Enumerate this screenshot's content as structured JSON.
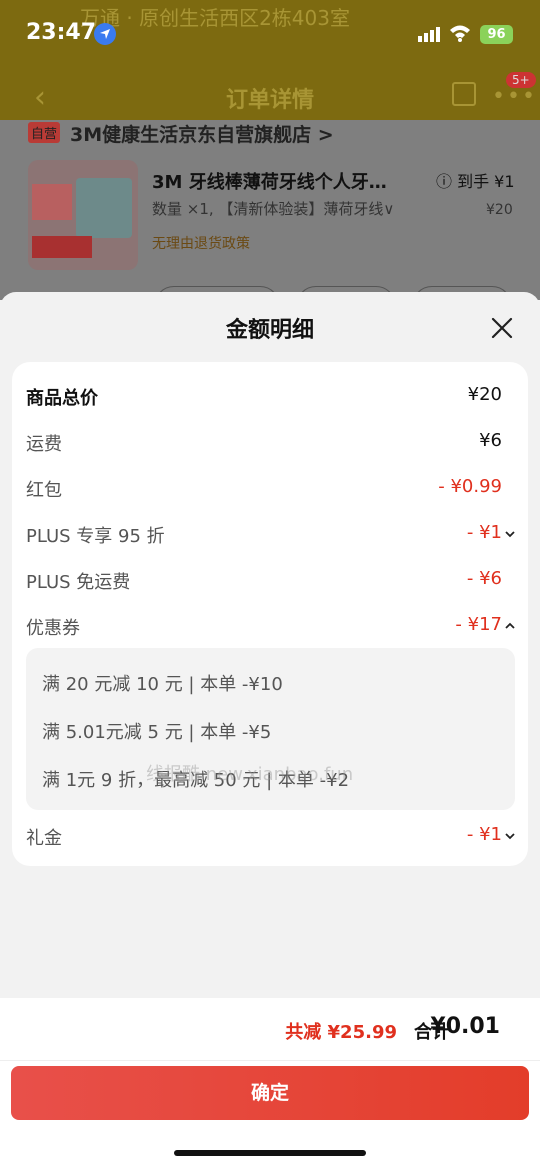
{
  "status": {
    "time": "23:47",
    "battery": "96"
  },
  "background": {
    "address": "万通 · 原创生活西区2栋403室",
    "nav_title": "订单详情",
    "nav_badge": "5+",
    "shop_tag": "自营",
    "shop_name": "3M健康生活京东自营旗舰店 >",
    "product_title": "3M 牙线棒薄荷牙线个人牙…",
    "product_spec": "数量 ×1, 【清新体验装】薄荷牙线∨",
    "product_policy": "无理由退货政策",
    "product_price": "ⓘ 到手 ¥1",
    "product_orig": "¥20"
  },
  "sheet": {
    "title": "金额明细",
    "rows": [
      {
        "label": "商品总价",
        "value": "¥20"
      },
      {
        "label": "运费",
        "value": "¥6"
      },
      {
        "label": "红包",
        "value": "- ¥0.99"
      },
      {
        "label": "PLUS 专享 95 折",
        "value": "- ¥1"
      },
      {
        "label": "PLUS 免运费",
        "value": "- ¥6"
      },
      {
        "label": "优惠券",
        "value": "- ¥17"
      },
      {
        "label": "礼金",
        "value": "- ¥1"
      }
    ],
    "coupons": [
      "满 20 元减 10 元 | 本单 -¥10",
      "满 5.01元减 5 元 | 本单 -¥5",
      "满 1元 9 折，最高减 50 元 | 本单 -¥2"
    ],
    "watermark": "线报酷 new.xianbao.fun"
  },
  "footer": {
    "saved": "共减 ¥25.99",
    "total_label": "合计",
    "total_value": "¥0.01",
    "confirm": "确定"
  },
  "colors": {
    "accent": "#e0301e",
    "button": "#e8504a"
  }
}
